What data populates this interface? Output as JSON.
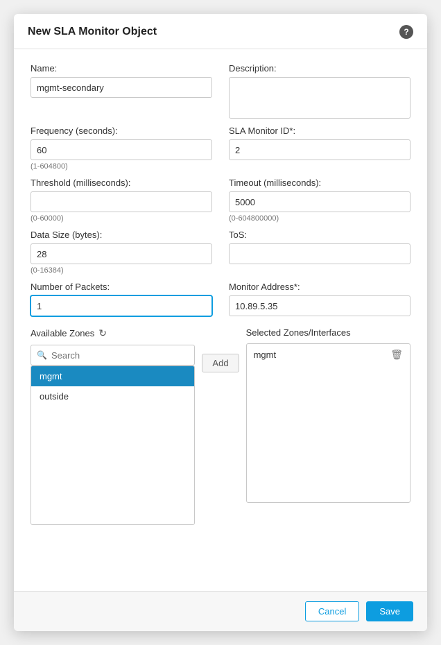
{
  "dialog": {
    "title": "New SLA Monitor Object",
    "help_label": "?"
  },
  "form": {
    "name_label": "Name:",
    "name_value": "mgmt-secondary",
    "description_label": "Description:",
    "description_value": "",
    "frequency_label": "Frequency (seconds):",
    "frequency_value": "60",
    "frequency_hint": "(1-604800)",
    "sla_monitor_id_label": "SLA Monitor ID*:",
    "sla_monitor_id_value": "2",
    "threshold_label": "Threshold (milliseconds):",
    "threshold_value": "",
    "threshold_hint": "(0-60000)",
    "timeout_label": "Timeout (milliseconds):",
    "timeout_value": "5000",
    "timeout_hint": "(0-604800000)",
    "data_size_label": "Data Size (bytes):",
    "data_size_value": "28",
    "data_size_hint": "(0-16384)",
    "tos_label": "ToS:",
    "tos_value": "",
    "num_packets_label": "Number of Packets:",
    "num_packets_value": "1",
    "monitor_address_label": "Monitor Address*:",
    "monitor_address_value": "10.89.5.35"
  },
  "zones": {
    "available_label": "Available Zones",
    "search_placeholder": "Search",
    "add_button_label": "Add",
    "selected_label": "Selected Zones/Interfaces",
    "available_items": [
      {
        "id": "mgmt",
        "label": "mgmt",
        "selected": true
      },
      {
        "id": "outside",
        "label": "outside",
        "selected": false
      }
    ],
    "selected_items": [
      {
        "id": "mgmt",
        "label": "mgmt"
      }
    ]
  },
  "footer": {
    "cancel_label": "Cancel",
    "save_label": "Save"
  }
}
